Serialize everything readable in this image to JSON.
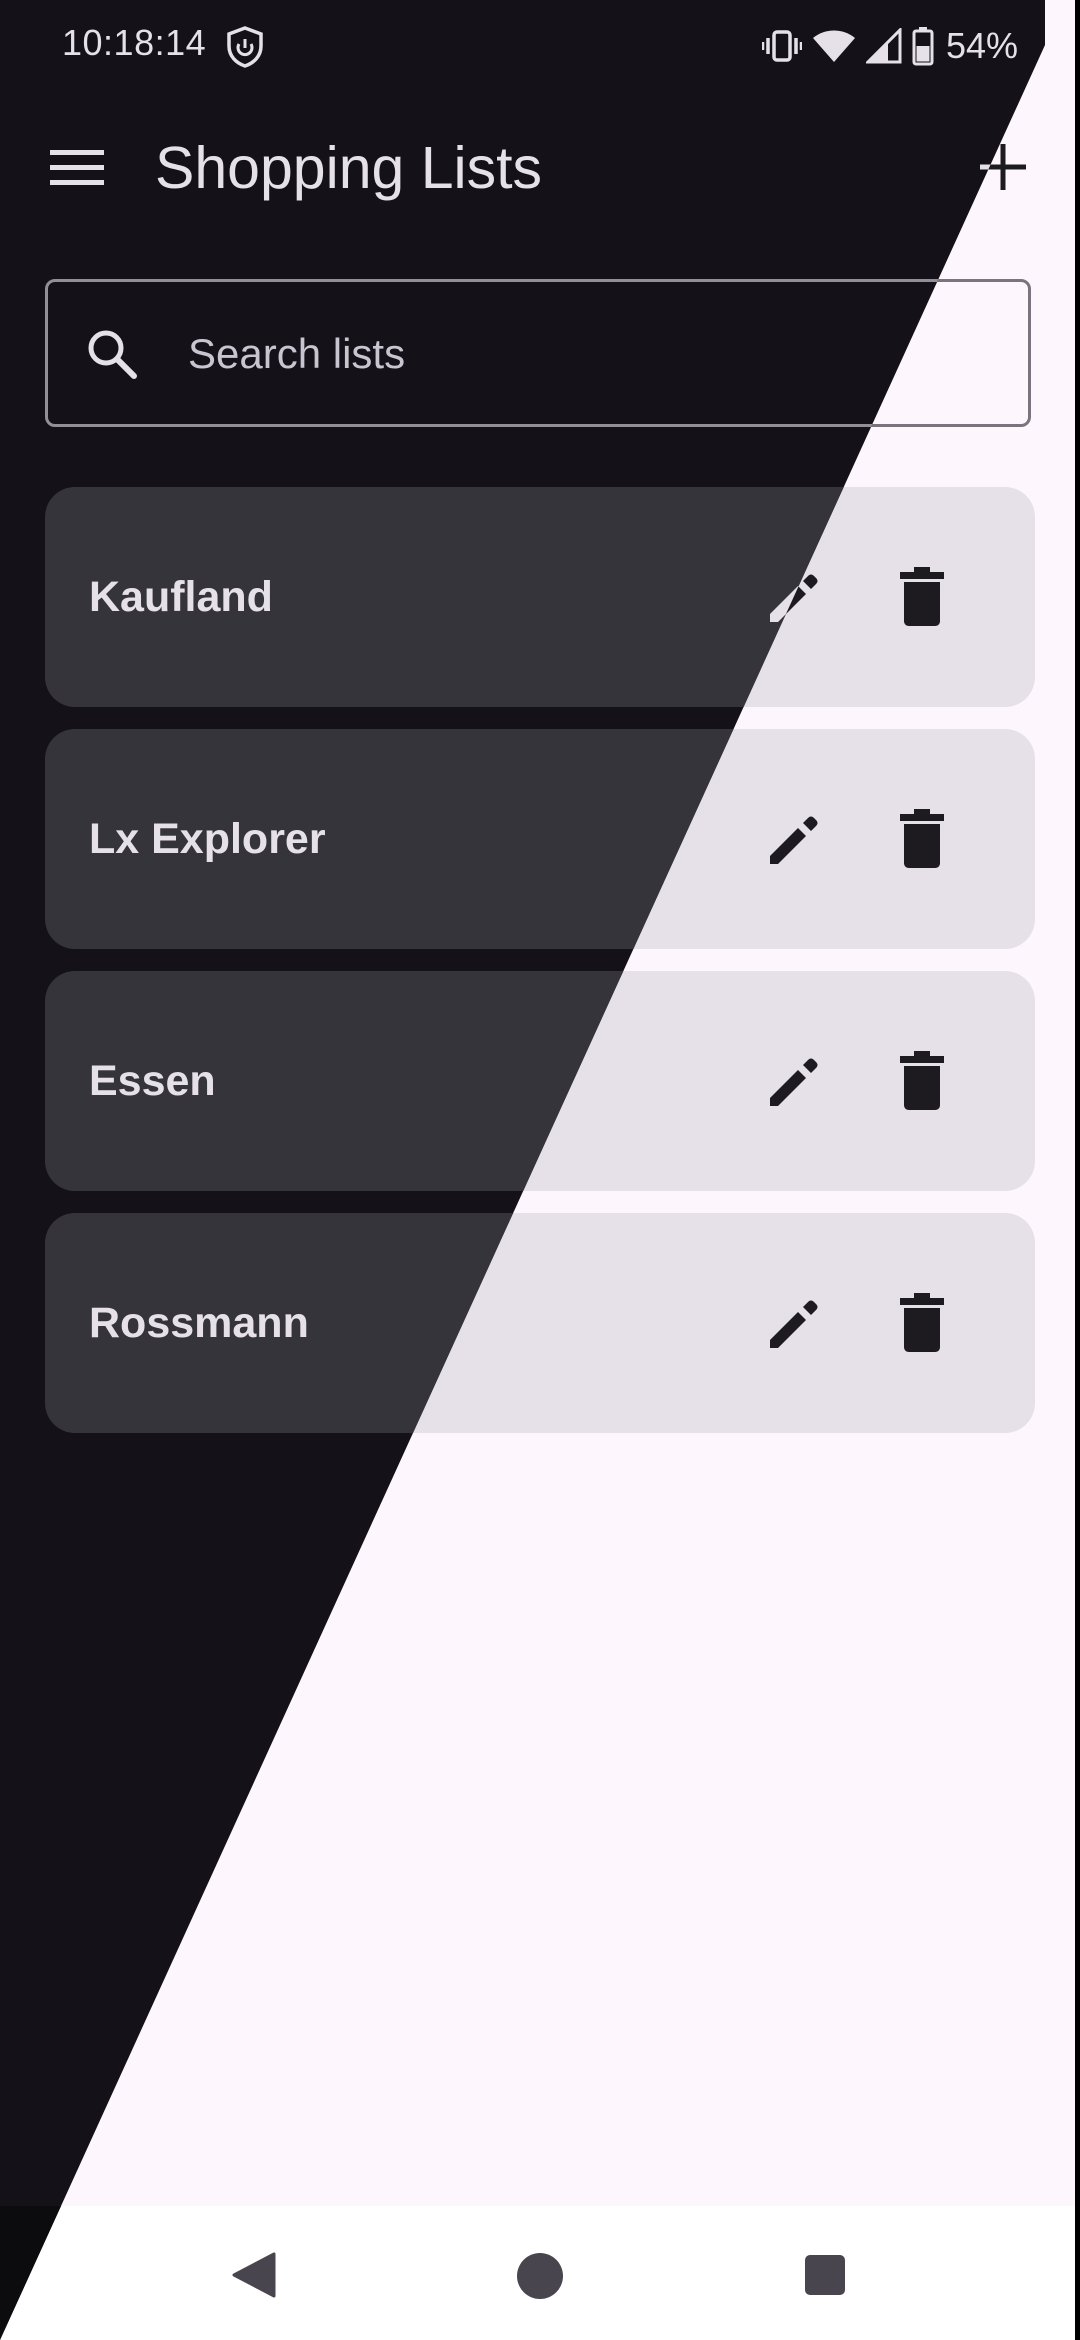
{
  "status_bar": {
    "time": "10:18:14",
    "battery_percent": "54%",
    "icons": [
      "shield-icon",
      "vibrate-icon",
      "wifi-icon",
      "signal-icon",
      "battery-icon"
    ]
  },
  "app_bar": {
    "title": "Shopping Lists",
    "menu_icon": "menu-icon",
    "add_icon": "add-icon"
  },
  "search": {
    "placeholder": "Search lists",
    "value": ""
  },
  "lists": [
    {
      "name": "Kaufland"
    },
    {
      "name": "Lx Explorer"
    },
    {
      "name": "Essen"
    },
    {
      "name": "Rossmann"
    }
  ],
  "navigation": [
    "back-icon",
    "home-icon",
    "recents-icon"
  ],
  "colors": {
    "dark_background": "#141218",
    "dark_card": "#36343b",
    "light_background": "#fdf7fd",
    "light_card": "#e6e0e9"
  }
}
